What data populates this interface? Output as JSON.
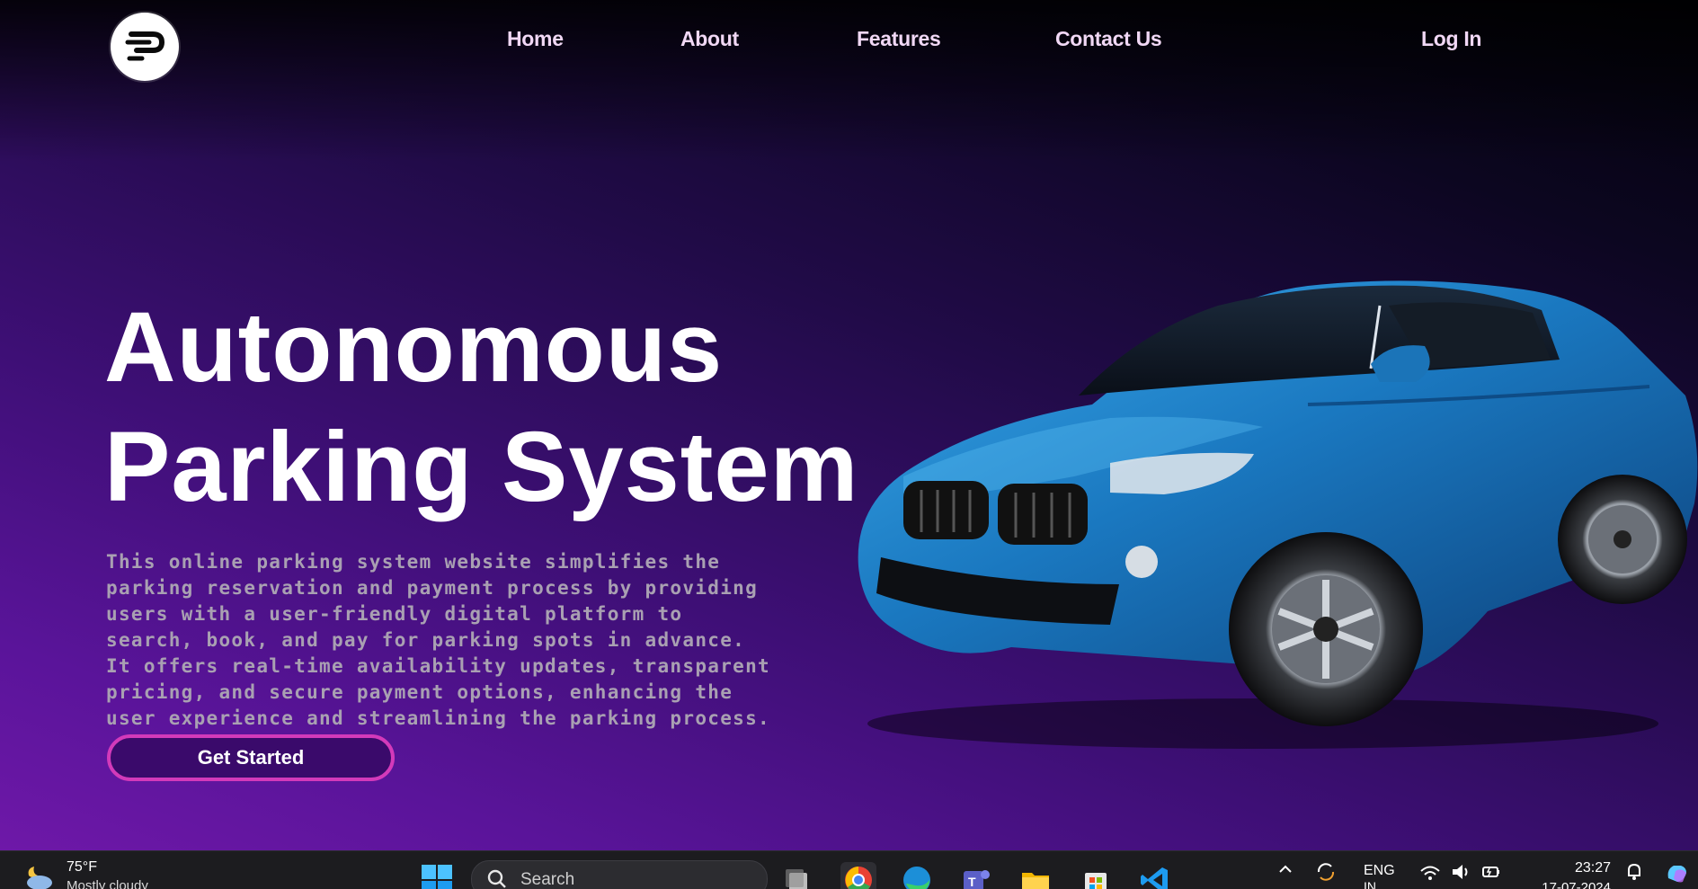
{
  "nav": {
    "logo_text": "P",
    "links": [
      {
        "label": "Home"
      },
      {
        "label": "About"
      },
      {
        "label": "Features"
      },
      {
        "label": "Contact Us"
      }
    ],
    "login_label": "Log In"
  },
  "hero": {
    "title_line1": "Autonomous",
    "title_line2": "Parking System",
    "description": "This online parking system website simplifies the parking reservation and payment process by providing users with a user-friendly digital platform to search, book, and pay for parking spots in advance. It offers real-time availability updates, transparent pricing, and secure payment options, enhancing the user experience and streamlining the parking process.",
    "cta_label": "Get Started"
  },
  "taskbar": {
    "weather_temp": "75°F",
    "weather_condition": "Mostly cloudy",
    "search_placeholder": "Search",
    "lang_line1": "ENG",
    "lang_line2": "IN",
    "time": "23:27",
    "date": "17-07-2024"
  },
  "colors": {
    "accent": "#d33aba",
    "nav_text": "#f1d8f5",
    "car_blue": "#1f7fc4"
  }
}
